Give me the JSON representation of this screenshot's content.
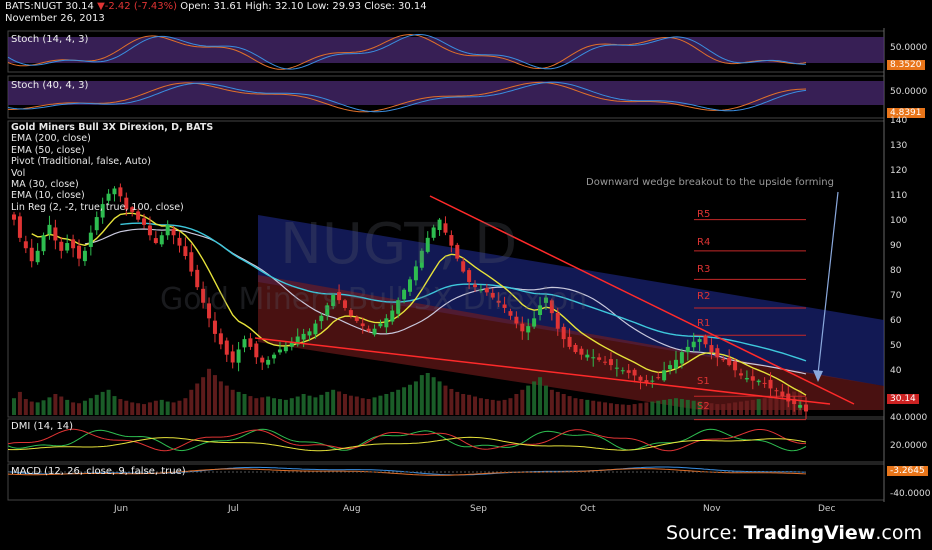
{
  "header": {
    "symbol": "BATS:NUGT",
    "last": "30.14",
    "change": "-2.42 (-7.43%)",
    "open_label": "Open:",
    "open": "31.61",
    "high_label": "High:",
    "high": "32.10",
    "low_label": "Low:",
    "low": "29.93",
    "close_label": "Close:",
    "close": "30.14",
    "date": "November 26, 2013"
  },
  "panels": {
    "stoch1": {
      "label": "Stoch (14, 4, 3)",
      "tick": "50.0000",
      "value": "8.3520"
    },
    "stoch2": {
      "label": "Stoch (40, 4, 3)",
      "tick": "50.0000",
      "value": "4.8391"
    },
    "dmi": {
      "label": "DMI (14, 14)",
      "ticks": [
        "40.0000",
        "20.0000"
      ]
    },
    "macd": {
      "label": "MACD (12, 26, close, 9, false, true)",
      "value": "-3.2645",
      "tick": "-40.0000"
    }
  },
  "legend": {
    "title": "Gold Miners Bull 3X Direxion, D, BATS",
    "items": [
      "EMA (200, close)",
      "EMA (50, close)",
      "Pivot (Traditional, false, Auto)",
      "Vol",
      "MA (30, close)",
      "EMA (10, close)",
      "Lin Reg (2, -2, true, true, 100, close)"
    ]
  },
  "watermark": {
    "ticker": "NUGT, D",
    "name": "Gold Miners Bull 3X Direxion"
  },
  "annotation": "Downward wedge breakout to the upside forming",
  "pivots": [
    "R5",
    "R4",
    "R3",
    "R2",
    "R1",
    "S1",
    "S2"
  ],
  "price_tag": "30.14",
  "source": {
    "prefix": "Source: ",
    "brand": "TradingView",
    "suffix": ".com"
  },
  "colors": {
    "up": "#2ebd50",
    "down": "#e03434",
    "ema10": "#e6e23a",
    "ema50": "#3ec8dc",
    "ma30": "#c8c8dc",
    "price_tag": "#cc2222",
    "macd_tag": "#e8751a",
    "stoch_tag": "#e8751a"
  },
  "chart_data": {
    "type": "candlestick",
    "y_ticks": [
      140,
      130,
      120,
      110,
      100,
      90,
      80,
      70,
      60,
      50,
      40
    ],
    "ylim": [
      28,
      142
    ],
    "x_ticks": [
      "Jun",
      "Jul",
      "Aug",
      "Sep",
      "Oct",
      "Nov",
      "Dec"
    ],
    "pivot_levels": [
      104,
      92,
      81,
      70,
      59.5,
      36,
      27
    ],
    "close": [
      104,
      97,
      93,
      88,
      92,
      98,
      102,
      96,
      92,
      95,
      93,
      89,
      92,
      99,
      105,
      110,
      114,
      116,
      113,
      108,
      107,
      104,
      102,
      98,
      95,
      98,
      102,
      98,
      94,
      90,
      84,
      78,
      72,
      66,
      60,
      56,
      52,
      49,
      54,
      58,
      55,
      51,
      49,
      50,
      52,
      54,
      55,
      57,
      59,
      60,
      61,
      64,
      67,
      71,
      75,
      73,
      70,
      67,
      65,
      63,
      61,
      62,
      64,
      66,
      69,
      73,
      77,
      81,
      86,
      92,
      97,
      101,
      104,
      99,
      94,
      89,
      84,
      80,
      78,
      77,
      76,
      74,
      72,
      70,
      67,
      64,
      61,
      63,
      66,
      71,
      74,
      68,
      62,
      58,
      55,
      53,
      52,
      52,
      51,
      50,
      49,
      48,
      47,
      46,
      45,
      44,
      42,
      41,
      42,
      43,
      46,
      48,
      50,
      53,
      55,
      57,
      58,
      56,
      53,
      51,
      50,
      48,
      46,
      44,
      43,
      42,
      42,
      41,
      39,
      38,
      36,
      34,
      33,
      32.6,
      30.14
    ],
    "volume": [
      40,
      55,
      38,
      32,
      30,
      35,
      42,
      50,
      44,
      36,
      30,
      28,
      34,
      40,
      48,
      55,
      60,
      45,
      38,
      34,
      30,
      28,
      26,
      30,
      34,
      36,
      32,
      30,
      34,
      40,
      60,
      75,
      90,
      110,
      95,
      80,
      70,
      60,
      55,
      50,
      45,
      40,
      42,
      44,
      40,
      38,
      36,
      40,
      44,
      50,
      46,
      42,
      48,
      55,
      60,
      56,
      50,
      46,
      44,
      40,
      38,
      42,
      46,
      50,
      55,
      60,
      66,
      72,
      80,
      95,
      100,
      90,
      80,
      70,
      62,
      55,
      50,
      48,
      44,
      40,
      38,
      36,
      34,
      36,
      40,
      50,
      60,
      70,
      80,
      90,
      70,
      60,
      55,
      50,
      45,
      40,
      38,
      36,
      34,
      32,
      30,
      28,
      26,
      25,
      24,
      26,
      28,
      30,
      32,
      34,
      36,
      38,
      40,
      38,
      36,
      34,
      32,
      30,
      28,
      26,
      26,
      28,
      30,
      32,
      34,
      36,
      38,
      40,
      42,
      44,
      48,
      52,
      56,
      60
    ]
  }
}
